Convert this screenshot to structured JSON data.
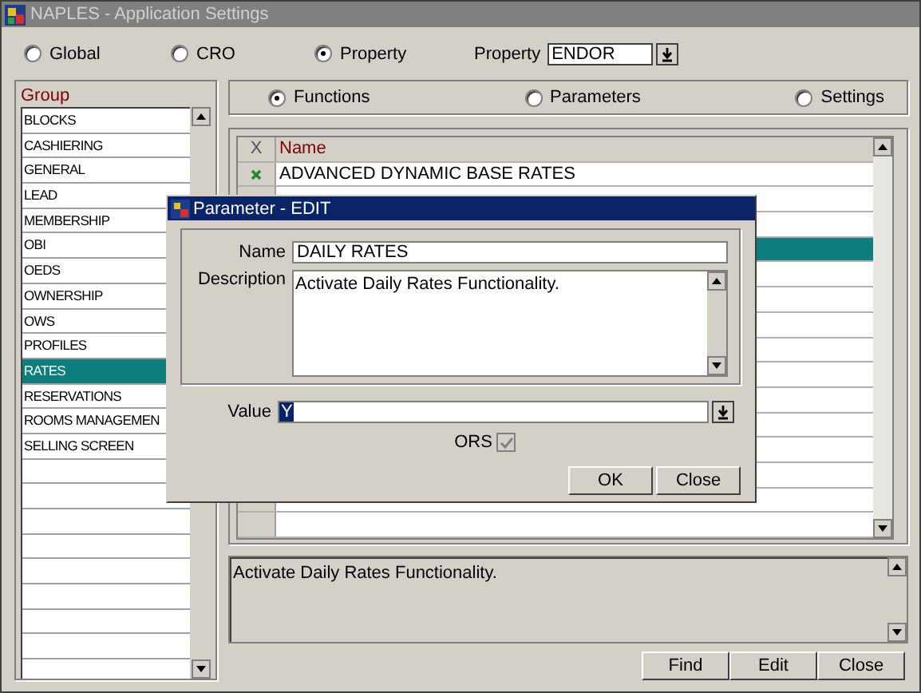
{
  "window": {
    "title": "NAPLES - Application Settings"
  },
  "scope_options": [
    {
      "label": "Global",
      "selected": false
    },
    {
      "label": "CRO",
      "selected": false
    },
    {
      "label": "Property",
      "selected": true
    }
  ],
  "property": {
    "label": "Property",
    "value": "ENDOR"
  },
  "group": {
    "label": "Group",
    "items": [
      {
        "label": "BLOCKS",
        "selected": false
      },
      {
        "label": "CASHIERING",
        "selected": false
      },
      {
        "label": "GENERAL",
        "selected": false
      },
      {
        "label": "LEAD",
        "selected": false
      },
      {
        "label": "MEMBERSHIP",
        "selected": false
      },
      {
        "label": "OBI",
        "selected": false
      },
      {
        "label": "OEDS",
        "selected": false
      },
      {
        "label": "OWNERSHIP",
        "selected": false
      },
      {
        "label": "OWS",
        "selected": false
      },
      {
        "label": "PROFILES",
        "selected": false
      },
      {
        "label": "RATES",
        "selected": true
      },
      {
        "label": "RESERVATIONS",
        "selected": false
      },
      {
        "label": "ROOMS MANAGEMEN",
        "selected": false
      },
      {
        "label": "SELLING SCREEN",
        "selected": false
      }
    ]
  },
  "view_options": [
    {
      "label": "Functions",
      "selected": true
    },
    {
      "label": "Parameters",
      "selected": false
    },
    {
      "label": "Settings",
      "selected": false
    }
  ],
  "table": {
    "columns": [
      "X",
      "Name"
    ],
    "rows": [
      {
        "checked": true,
        "name": "ADVANCED DYNAMIC BASE RATES",
        "selected": false
      },
      {
        "checked": false,
        "selected": false
      },
      {
        "checked": false,
        "selected": false
      },
      {
        "checked": false,
        "selected": true
      }
    ]
  },
  "description_panel": {
    "text": "Activate Daily Rates Functionality."
  },
  "buttons": [
    "Find",
    "Edit",
    "Close"
  ],
  "dialog": {
    "title": "Parameter - EDIT",
    "name": {
      "label": "Name",
      "value": "DAILY RATES"
    },
    "description": {
      "label": "Description",
      "value": "Activate Daily Rates Functionality."
    },
    "value": {
      "label": "Value",
      "value": "Y"
    },
    "ors": {
      "label": "ORS",
      "checked": true,
      "disabled": true
    },
    "buttons": [
      "OK",
      "Close"
    ]
  }
}
